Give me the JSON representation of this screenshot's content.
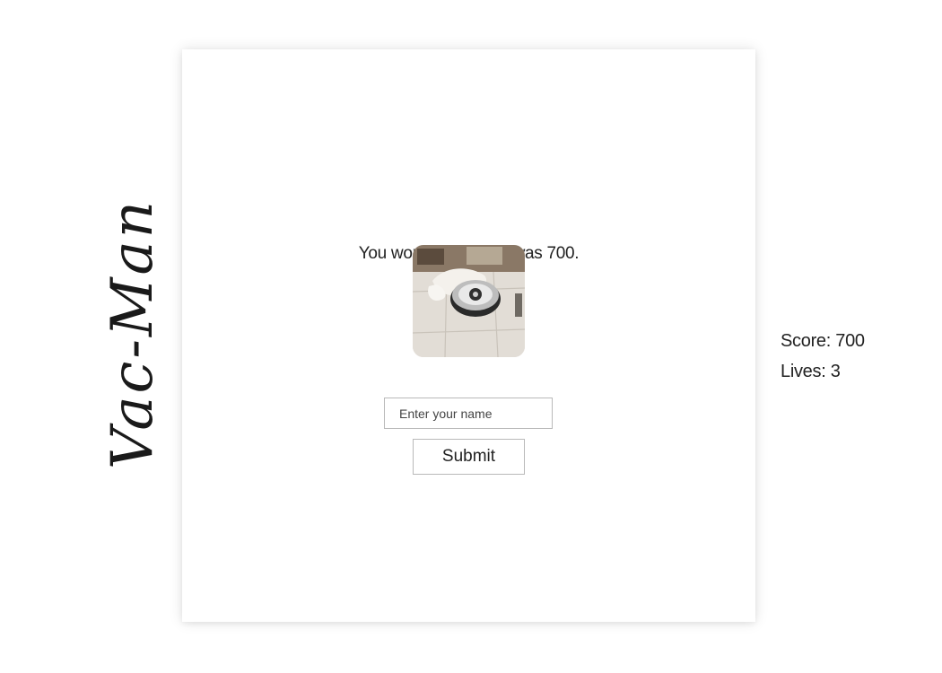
{
  "game": {
    "title": "Vac-Man"
  },
  "board": {
    "result_message": "You won! Your score was 700.",
    "image_icon": "robot-vacuum-with-dog-icon"
  },
  "form": {
    "name_placeholder": "Enter your name",
    "name_value": "",
    "submit_label": "Submit"
  },
  "stats": {
    "score_text": "Score: 700",
    "lives_text": "Lives: 3",
    "score": 700,
    "lives": 3
  }
}
